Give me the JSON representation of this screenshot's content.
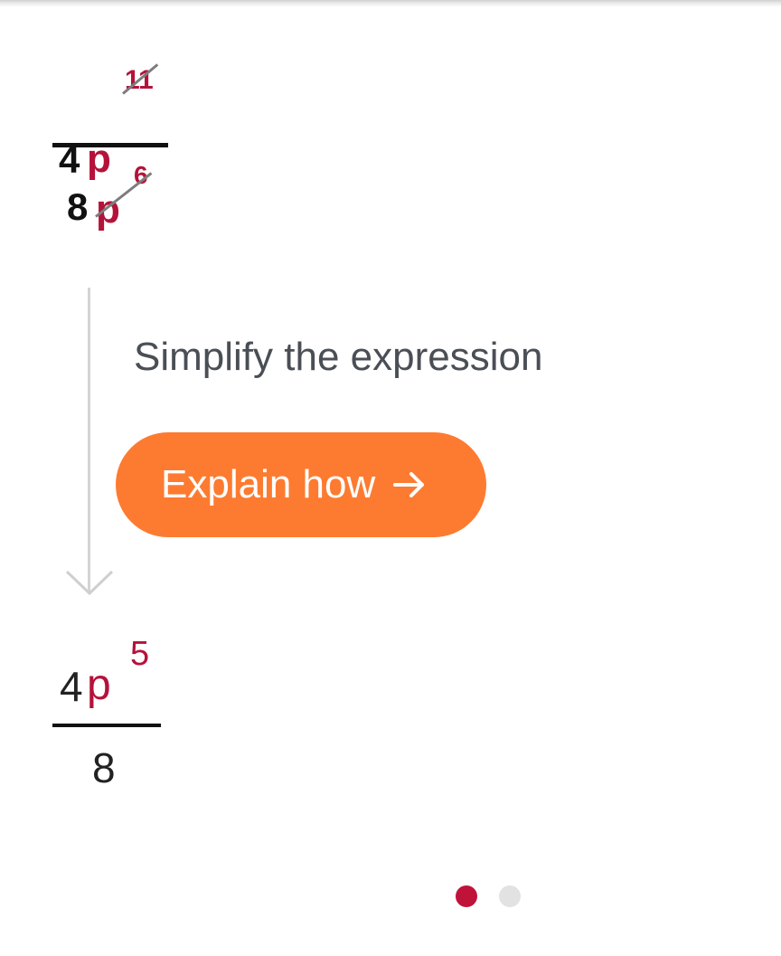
{
  "expression": {
    "numerator": {
      "coefficient": "4",
      "variable": "p",
      "exponent": "11"
    },
    "denominator": {
      "coefficient": "8",
      "variable": "p",
      "exponent": "6"
    }
  },
  "step": {
    "description": "Simplify the expression",
    "button_label": "Explain how",
    "button_icon": "arrow-right-icon"
  },
  "result": {
    "numerator": {
      "coefficient": "4",
      "variable": "p",
      "exponent": "5"
    },
    "denominator": {
      "coefficient": "8"
    }
  },
  "pagination": {
    "total": 2,
    "active": 1
  },
  "colors": {
    "accent": "#b5123a",
    "button": "#fd7b30",
    "text": "#4a4e55",
    "dot_active": "#c0133a",
    "dot_inactive": "#e2e2e2"
  }
}
